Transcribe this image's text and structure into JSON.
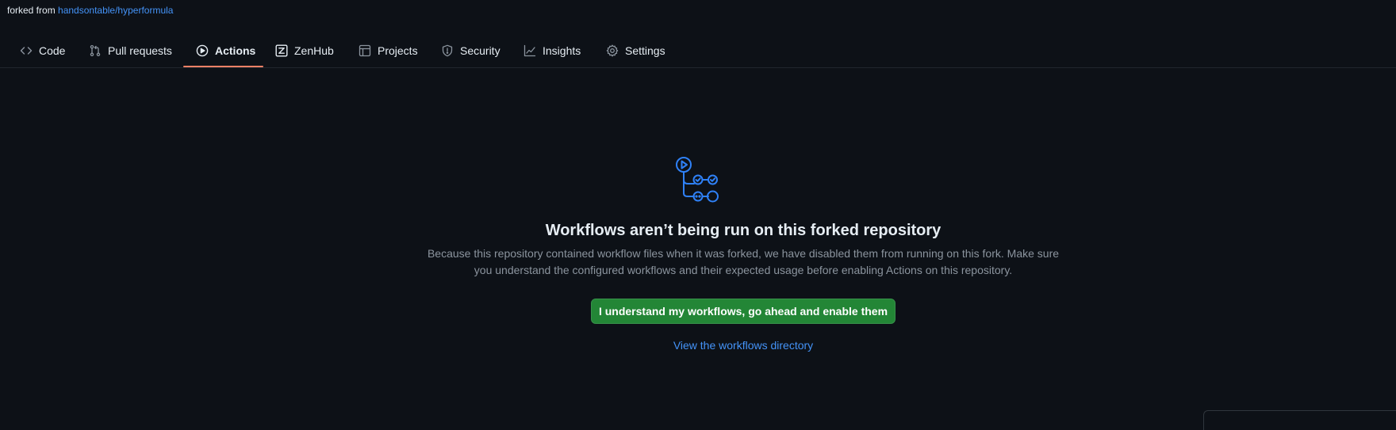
{
  "fork": {
    "prefix": "forked from",
    "source": "handsontable/hyperformula"
  },
  "tabs": [
    {
      "label": "Code",
      "icon": "code-icon",
      "selected": false
    },
    {
      "label": "Pull requests",
      "icon": "pull-request-icon",
      "selected": false
    },
    {
      "label": "Actions",
      "icon": "play-icon",
      "selected": true
    },
    {
      "label": "ZenHub",
      "icon": "zenhub-icon",
      "selected": false
    },
    {
      "label": "Projects",
      "icon": "table-icon",
      "selected": false
    },
    {
      "label": "Security",
      "icon": "shield-icon",
      "selected": false
    },
    {
      "label": "Insights",
      "icon": "graph-icon",
      "selected": false
    },
    {
      "label": "Settings",
      "icon": "gear-icon",
      "selected": false
    }
  ],
  "blankslate": {
    "icon": "workflow-icon",
    "title": "Workflows aren’t being run on this forked repository",
    "description": "Because this repository contained workflow files when it was forked, we have disabled them from running on this fork. Make sure you understand the configured workflows and their expected usage before enabling Actions on this repository.",
    "button_label": "I understand my workflows, go ahead and enable them",
    "link_label": "View the workflows directory"
  },
  "colors": {
    "background": "#0d1117",
    "link": "#4493f8",
    "accent_underline": "#f78166",
    "primary_button": "#238636",
    "icon_blue": "#2f81f7",
    "muted_text": "#8b949e"
  }
}
